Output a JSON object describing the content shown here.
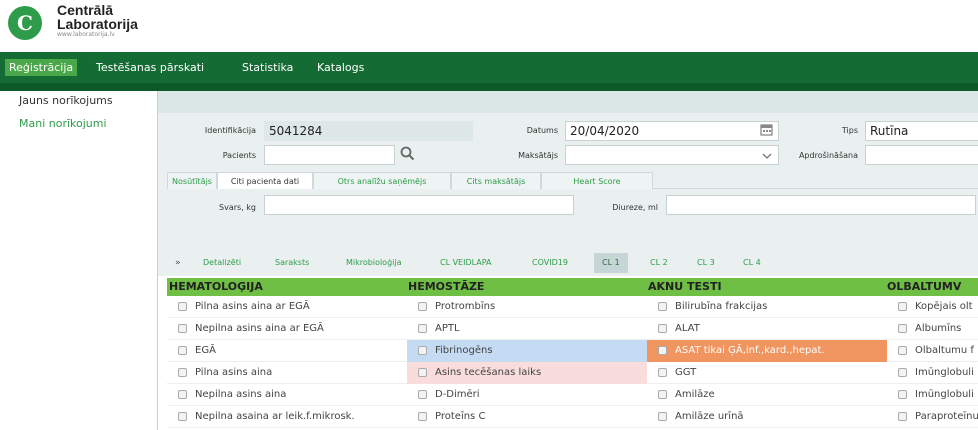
{
  "logo": {
    "mark": "C",
    "line1": "Centrālā",
    "line2": "Laboratorija",
    "url": "www.laboratorija.lv"
  },
  "nav": {
    "items": [
      "Reģistrācija",
      "Testēšanas pārskati",
      "Statistika",
      "Katalogs"
    ],
    "active": "Reģistrācija"
  },
  "sidebar": {
    "items": [
      "Jauns norīkojums",
      "Mani norīkojumi"
    ]
  },
  "form": {
    "identifikacija_label": "Identifikācija",
    "identifikacija_value": "5041284",
    "datums_label": "Datums",
    "datums_value": "20/04/2020",
    "tips_label": "Tips",
    "tips_value": "Rutīna",
    "pacients_label": "Pacients",
    "pacients_value": "",
    "maksatajs_label": "Maksātājs",
    "maksatajs_value": "",
    "apdrosinasana_label": "Apdrošināšana",
    "apdrosinasana_value": "",
    "svars_label": "Svars, kg",
    "svars_value": "",
    "diureze_label": "Diureze, ml",
    "diureze_value": ""
  },
  "tabs": [
    "Nosūtītājs",
    "Citi pacienta dati",
    "Otrs analīžu saņēmējs",
    "Cits maksātājs",
    "Heart Score"
  ],
  "active_tab": "Citi pacienta dati",
  "subtabs": {
    "chevron": "»",
    "items": [
      "Detalizēti",
      "Saraksts",
      "Mikrobioloģija",
      "CL VEIDLAPA",
      "COVID19",
      "CL 1",
      "CL 2",
      "CL 3",
      "CL 4"
    ],
    "active": "CL 1"
  },
  "categories": [
    "HEMATOLOĢIJA",
    "HEMOSTĀZE",
    "AKNU TESTI",
    "OLBALTUMV"
  ],
  "rows": [
    [
      "Pilna asins aina ar EGĀ",
      "Protrombīns",
      "Bilirubīna frakcijas",
      "Kopējais olt"
    ],
    [
      "Nepilna asins aina ar EGĀ",
      "APTL",
      "ALAT",
      "Albumīns"
    ],
    [
      "EGĀ",
      "Fibrinogēns",
      "ASAT tikai ĢĀ,inf.,kard.,hepat.",
      "Olbaltumu f"
    ],
    [
      "Pilna asins aina",
      "Asins tecēšanas laiks",
      "GGT",
      "Imūnglobuli"
    ],
    [
      "Nepilna asins aina",
      "D-Dimēri",
      "Amilāze",
      "Imūnglobuli"
    ],
    [
      "Nepilna asaina ar leik.f.mikrosk.",
      "Proteīns C",
      "Amilāze urīnā",
      "Paraproteīnu"
    ]
  ],
  "highlights": {
    "fibrinogen": "#c5daf3",
    "asins_tecesanas": "#f9dcdc",
    "asat": "#f0955f"
  },
  "colors": {
    "brand_green": "#2e9c4a",
    "nav_green": "#156b34",
    "category_green": "#6fbf45"
  }
}
